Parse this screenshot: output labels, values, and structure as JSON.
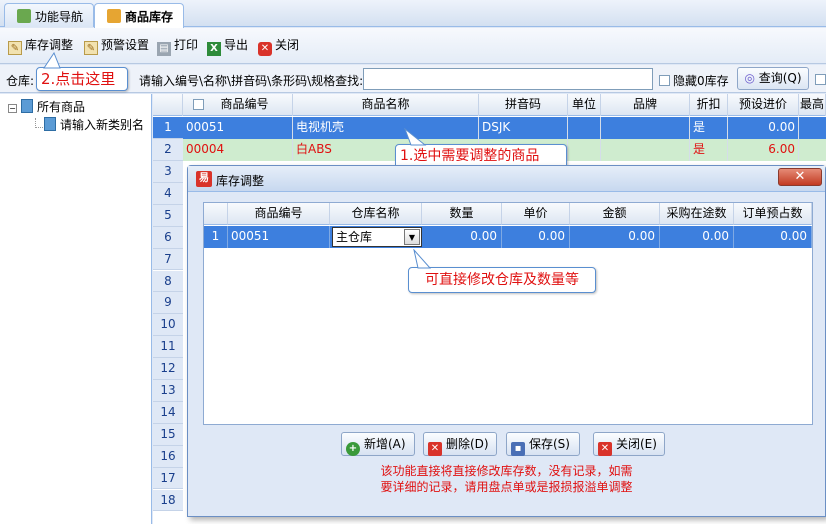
{
  "tabs": [
    {
      "label": "功能导航",
      "icon": "home-icon",
      "active": false
    },
    {
      "label": "商品库存",
      "icon": "box-icon",
      "active": true
    }
  ],
  "toolbar": {
    "adjust": "库存调整",
    "alert": "预警设置",
    "print": "打印",
    "export": "导出",
    "close": "关闭"
  },
  "search": {
    "warehouse_label": "仓库:",
    "prompt": "请输入编号\\名称\\拼音码\\条形码\\规格查找:",
    "value": "",
    "hide_zero": "隐藏0库存",
    "query": "查询(Q)"
  },
  "tree": {
    "root": "所有商品",
    "child": "请输入新类别名"
  },
  "grid": {
    "headers": [
      "商品编号",
      "商品名称",
      "拼音码",
      "单位",
      "品牌",
      "折扣",
      "预设进价",
      "最高"
    ],
    "rows": [
      {
        "num": "1",
        "code": "00051",
        "name": "电视机壳",
        "pinyin": "DSJK",
        "unit": "",
        "brand": "",
        "discount": "是",
        "price": "0.00"
      },
      {
        "num": "2",
        "code": "00004",
        "name": "白ABS",
        "pinyin": "",
        "unit": "",
        "brand": "",
        "discount": "是",
        "price": "6.00"
      }
    ],
    "row_numbers": [
      "3",
      "4",
      "5",
      "6",
      "7",
      "8",
      "9",
      "10",
      "11",
      "12",
      "13",
      "14",
      "15",
      "16",
      "17",
      "18"
    ]
  },
  "callouts": {
    "click_here": "2.点击这里",
    "select_item": "1.选中需要调整的商品",
    "edit_hint": "可直接修改仓库及数量等"
  },
  "dialog": {
    "title": "库存调整",
    "close_glyph": "✕",
    "headers": [
      "商品编号",
      "仓库名称",
      "数量",
      "单价",
      "金额",
      "采购在途数",
      "订单预占数"
    ],
    "row": {
      "num": "1",
      "code": "00051",
      "warehouse": "主仓库",
      "qty": "0.00",
      "unit_price": "0.00",
      "amount": "0.00",
      "in_transit": "0.00",
      "reserved": "0.00"
    },
    "buttons": {
      "add": "新增(A)",
      "delete": "删除(D)",
      "save": "保存(S)",
      "close": "关闭(E)"
    },
    "note_line1": "该功能直接将直接修改库存数，没有记录，如需",
    "note_line2": "要详细的记录，请用盘点单或是报损报溢单调整"
  },
  "colors": {
    "selected_row": "#3d7fde",
    "row2_bg": "#cfeccf",
    "red_text": "#e01010"
  }
}
